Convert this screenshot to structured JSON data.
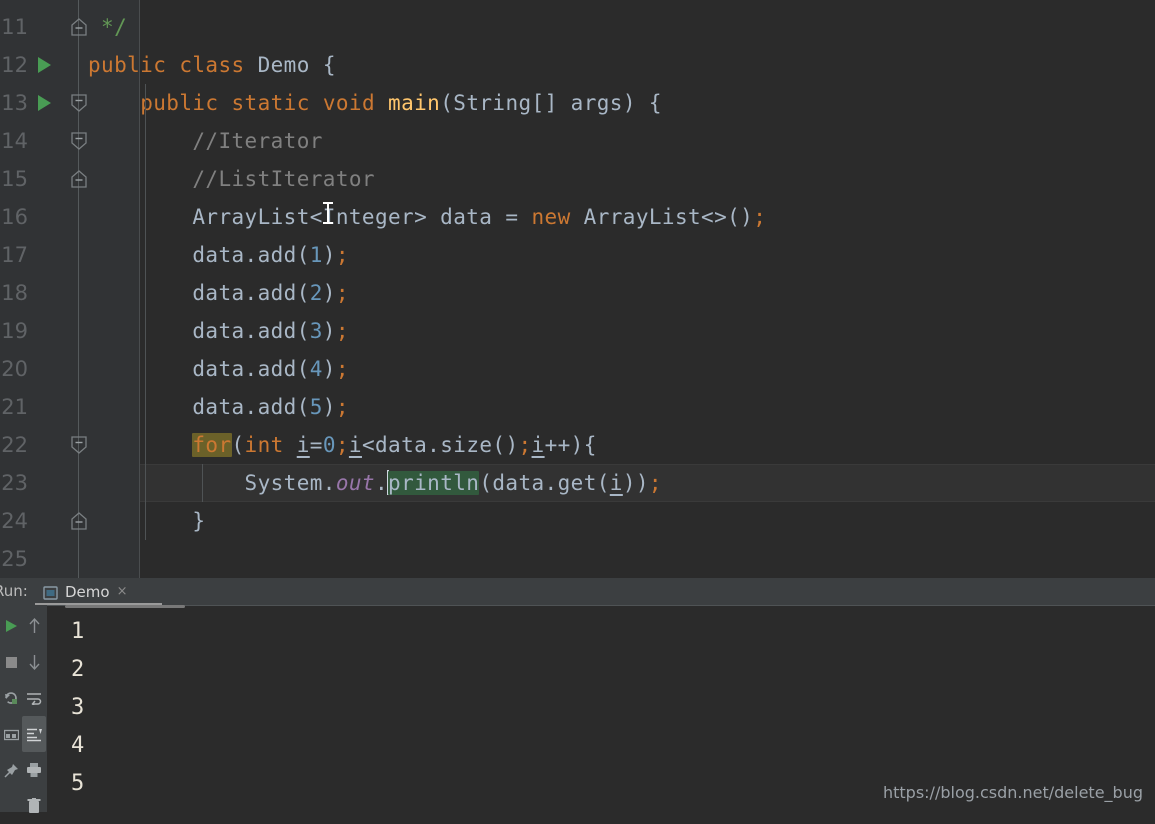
{
  "editor": {
    "theme": "darcula",
    "background": "#2b2b2b",
    "gutter_background": "#313335",
    "accent_run_arrow": "#499c54",
    "caret_color": "#cfd8e0",
    "current_line": 23,
    "lines": [
      {
        "number": "",
        "partial": true,
        "runnable": false,
        "fold": "none"
      },
      {
        "number": "11",
        "runnable": false,
        "fold": "end"
      },
      {
        "number": "12",
        "runnable": true,
        "fold": "none"
      },
      {
        "number": "13",
        "runnable": true,
        "fold": "start"
      },
      {
        "number": "14",
        "runnable": false,
        "fold": "start"
      },
      {
        "number": "15",
        "runnable": false,
        "fold": "end"
      },
      {
        "number": "16",
        "runnable": false,
        "fold": "none"
      },
      {
        "number": "17",
        "runnable": false,
        "fold": "none"
      },
      {
        "number": "18",
        "runnable": false,
        "fold": "none"
      },
      {
        "number": "19",
        "runnable": false,
        "fold": "none"
      },
      {
        "number": "20",
        "runnable": false,
        "fold": "none"
      },
      {
        "number": "21",
        "runnable": false,
        "fold": "none"
      },
      {
        "number": "22",
        "runnable": false,
        "fold": "start"
      },
      {
        "number": "23",
        "runnable": false,
        "fold": "none"
      },
      {
        "number": "24",
        "runnable": false,
        "fold": "end"
      },
      {
        "number": "25",
        "runnable": false,
        "fold": "none"
      }
    ],
    "code_plain": [
      "",
      " */",
      "public class Demo {",
      "    public static void main(String[] args) {",
      "        //Iterator",
      "        //ListIterator",
      "        ArrayList<Integer> data = new ArrayList<>();",
      "        data.add(1);",
      "        data.add(2);",
      "        data.add(3);",
      "        data.add(4);",
      "        data.add(5);",
      "        for(int i=0;i<data.size();i++){",
      "            System.out.println(data.get(i));",
      "        }",
      ""
    ],
    "tokens": {
      "l11": {
        "comment_close": " */"
      },
      "l12": {
        "kw_public": "public",
        "kw_class": "class",
        "name": "Demo",
        "brace": "{"
      },
      "l13": {
        "kw_public": "public",
        "kw_static": "static",
        "kw_void": "void",
        "method": "main",
        "params": "(String[] args) {"
      },
      "l14": {
        "comment": "//Iterator"
      },
      "l15": {
        "comment": "//ListIterator"
      },
      "l16": {
        "type": "ArrayList<Integer>",
        "var": "data",
        "eq": "=",
        "kw_new": "new",
        "ctor": "ArrayList<>()",
        "semi": ";"
      },
      "l17": {
        "call": "data.add(",
        "num": "1",
        "close": ")",
        "semi": ";"
      },
      "l18": {
        "call": "data.add(",
        "num": "2",
        "close": ")",
        "semi": ";"
      },
      "l19": {
        "call": "data.add(",
        "num": "3",
        "close": ")",
        "semi": ";"
      },
      "l20": {
        "call": "data.add(",
        "num": "4",
        "close": ")",
        "semi": ";"
      },
      "l21": {
        "call": "data.add(",
        "num": "5",
        "close": ")",
        "semi": ";"
      },
      "l22": {
        "kw_for": "for",
        "open": "(",
        "kw_int": "int",
        "i1": "i",
        "assign": "=",
        "zero": "0",
        "s1": ";",
        "i2": "i",
        "cond": "<data.size()",
        "s2": ";",
        "i3": "i",
        "inc": "++",
        "close": "){"
      },
      "l23": {
        "sys": "System.",
        "out": "out",
        "dot": ".",
        "println": "println",
        "args": "(data.get(",
        "i": "i",
        "closers": "))",
        "semi": ";"
      },
      "l24": {
        "brace": "}"
      }
    },
    "highlights": {
      "keyword_highlight_color": "#6b6129",
      "identifier_highlight_color": "#32593d",
      "current_line_color": "#323232"
    },
    "mouse_cursor": "text-ibeam-cursor"
  },
  "run_panel": {
    "label": "Run:",
    "tab": {
      "icon": "run-configuration-icon",
      "label": "Demo",
      "close": "×"
    },
    "left_toolbar": [
      {
        "name": "rerun-button",
        "icon": "play-icon"
      },
      {
        "name": "stop-button",
        "icon": "stop-icon"
      },
      {
        "name": "rerun-failed-tests-button",
        "icon": "rerun-icon"
      },
      {
        "name": "layout-settings-button",
        "icon": "layout-icon"
      },
      {
        "name": "pin-tab-button",
        "icon": "pin-icon"
      }
    ],
    "right_toolbar": [
      {
        "name": "up-the-stack-trace-button",
        "icon": "arrow-up-icon",
        "active": false
      },
      {
        "name": "down-the-stack-trace-button",
        "icon": "arrow-down-icon",
        "active": false
      },
      {
        "name": "soft-wrap-button",
        "icon": "soft-wrap-icon",
        "active": false
      },
      {
        "name": "scroll-to-end-button",
        "icon": "scroll-to-end-icon",
        "active": true
      },
      {
        "name": "print-button",
        "icon": "printer-icon",
        "active": false
      },
      {
        "name": "clear-all-button",
        "icon": "trash-icon",
        "active": false
      }
    ],
    "console_output": [
      "1",
      "2",
      "3",
      "4",
      "5"
    ],
    "console_text_color": "#e8e3d7"
  },
  "watermark": "https://blog.csdn.net/delete_bug"
}
